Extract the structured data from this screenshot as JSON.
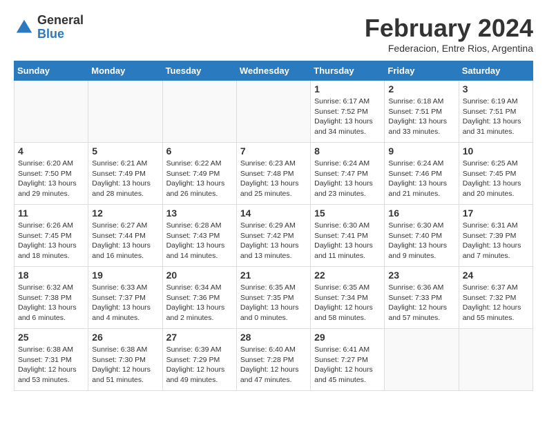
{
  "header": {
    "logo_general": "General",
    "logo_blue": "Blue",
    "month_title": "February 2024",
    "subtitle": "Federacion, Entre Rios, Argentina"
  },
  "weekdays": [
    "Sunday",
    "Monday",
    "Tuesday",
    "Wednesday",
    "Thursday",
    "Friday",
    "Saturday"
  ],
  "weeks": [
    [
      {
        "day": "",
        "info": ""
      },
      {
        "day": "",
        "info": ""
      },
      {
        "day": "",
        "info": ""
      },
      {
        "day": "",
        "info": ""
      },
      {
        "day": "1",
        "info": "Sunrise: 6:17 AM\nSunset: 7:52 PM\nDaylight: 13 hours\nand 34 minutes."
      },
      {
        "day": "2",
        "info": "Sunrise: 6:18 AM\nSunset: 7:51 PM\nDaylight: 13 hours\nand 33 minutes."
      },
      {
        "day": "3",
        "info": "Sunrise: 6:19 AM\nSunset: 7:51 PM\nDaylight: 13 hours\nand 31 minutes."
      }
    ],
    [
      {
        "day": "4",
        "info": "Sunrise: 6:20 AM\nSunset: 7:50 PM\nDaylight: 13 hours\nand 29 minutes."
      },
      {
        "day": "5",
        "info": "Sunrise: 6:21 AM\nSunset: 7:49 PM\nDaylight: 13 hours\nand 28 minutes."
      },
      {
        "day": "6",
        "info": "Sunrise: 6:22 AM\nSunset: 7:49 PM\nDaylight: 13 hours\nand 26 minutes."
      },
      {
        "day": "7",
        "info": "Sunrise: 6:23 AM\nSunset: 7:48 PM\nDaylight: 13 hours\nand 25 minutes."
      },
      {
        "day": "8",
        "info": "Sunrise: 6:24 AM\nSunset: 7:47 PM\nDaylight: 13 hours\nand 23 minutes."
      },
      {
        "day": "9",
        "info": "Sunrise: 6:24 AM\nSunset: 7:46 PM\nDaylight: 13 hours\nand 21 minutes."
      },
      {
        "day": "10",
        "info": "Sunrise: 6:25 AM\nSunset: 7:45 PM\nDaylight: 13 hours\nand 20 minutes."
      }
    ],
    [
      {
        "day": "11",
        "info": "Sunrise: 6:26 AM\nSunset: 7:45 PM\nDaylight: 13 hours\nand 18 minutes."
      },
      {
        "day": "12",
        "info": "Sunrise: 6:27 AM\nSunset: 7:44 PM\nDaylight: 13 hours\nand 16 minutes."
      },
      {
        "day": "13",
        "info": "Sunrise: 6:28 AM\nSunset: 7:43 PM\nDaylight: 13 hours\nand 14 minutes."
      },
      {
        "day": "14",
        "info": "Sunrise: 6:29 AM\nSunset: 7:42 PM\nDaylight: 13 hours\nand 13 minutes."
      },
      {
        "day": "15",
        "info": "Sunrise: 6:30 AM\nSunset: 7:41 PM\nDaylight: 13 hours\nand 11 minutes."
      },
      {
        "day": "16",
        "info": "Sunrise: 6:30 AM\nSunset: 7:40 PM\nDaylight: 13 hours\nand 9 minutes."
      },
      {
        "day": "17",
        "info": "Sunrise: 6:31 AM\nSunset: 7:39 PM\nDaylight: 13 hours\nand 7 minutes."
      }
    ],
    [
      {
        "day": "18",
        "info": "Sunrise: 6:32 AM\nSunset: 7:38 PM\nDaylight: 13 hours\nand 6 minutes."
      },
      {
        "day": "19",
        "info": "Sunrise: 6:33 AM\nSunset: 7:37 PM\nDaylight: 13 hours\nand 4 minutes."
      },
      {
        "day": "20",
        "info": "Sunrise: 6:34 AM\nSunset: 7:36 PM\nDaylight: 13 hours\nand 2 minutes."
      },
      {
        "day": "21",
        "info": "Sunrise: 6:35 AM\nSunset: 7:35 PM\nDaylight: 13 hours\nand 0 minutes."
      },
      {
        "day": "22",
        "info": "Sunrise: 6:35 AM\nSunset: 7:34 PM\nDaylight: 12 hours\nand 58 minutes."
      },
      {
        "day": "23",
        "info": "Sunrise: 6:36 AM\nSunset: 7:33 PM\nDaylight: 12 hours\nand 57 minutes."
      },
      {
        "day": "24",
        "info": "Sunrise: 6:37 AM\nSunset: 7:32 PM\nDaylight: 12 hours\nand 55 minutes."
      }
    ],
    [
      {
        "day": "25",
        "info": "Sunrise: 6:38 AM\nSunset: 7:31 PM\nDaylight: 12 hours\nand 53 minutes."
      },
      {
        "day": "26",
        "info": "Sunrise: 6:38 AM\nSunset: 7:30 PM\nDaylight: 12 hours\nand 51 minutes."
      },
      {
        "day": "27",
        "info": "Sunrise: 6:39 AM\nSunset: 7:29 PM\nDaylight: 12 hours\nand 49 minutes."
      },
      {
        "day": "28",
        "info": "Sunrise: 6:40 AM\nSunset: 7:28 PM\nDaylight: 12 hours\nand 47 minutes."
      },
      {
        "day": "29",
        "info": "Sunrise: 6:41 AM\nSunset: 7:27 PM\nDaylight: 12 hours\nand 45 minutes."
      },
      {
        "day": "",
        "info": ""
      },
      {
        "day": "",
        "info": ""
      }
    ]
  ]
}
